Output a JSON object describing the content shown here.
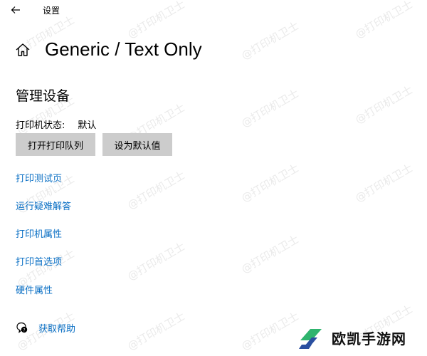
{
  "window": {
    "title": "设置"
  },
  "header": {
    "page_title": "Generic / Text Only"
  },
  "manage": {
    "section_title": "管理设备",
    "status_label": "打印机状态:",
    "status_value": "默认",
    "buttons": {
      "open_queue": "打开打印队列",
      "set_default": "设为默认值"
    }
  },
  "links": [
    "打印测试页",
    "运行疑难解答",
    "打印机属性",
    "打印首选项",
    "硬件属性"
  ],
  "help": {
    "label": "获取帮助"
  },
  "watermark": {
    "text": "@打印机卫士"
  },
  "logo": {
    "text": "欧凯手游网"
  },
  "colors": {
    "link": "#0a6fc4",
    "button_bg": "#cccccc",
    "background": "#ffffff",
    "logo_green": "#2fb46e",
    "logo_blue": "#2a4fa0"
  },
  "icons": {
    "back": "arrow-left-icon",
    "home": "home-icon",
    "help": "chat-help-icon"
  }
}
